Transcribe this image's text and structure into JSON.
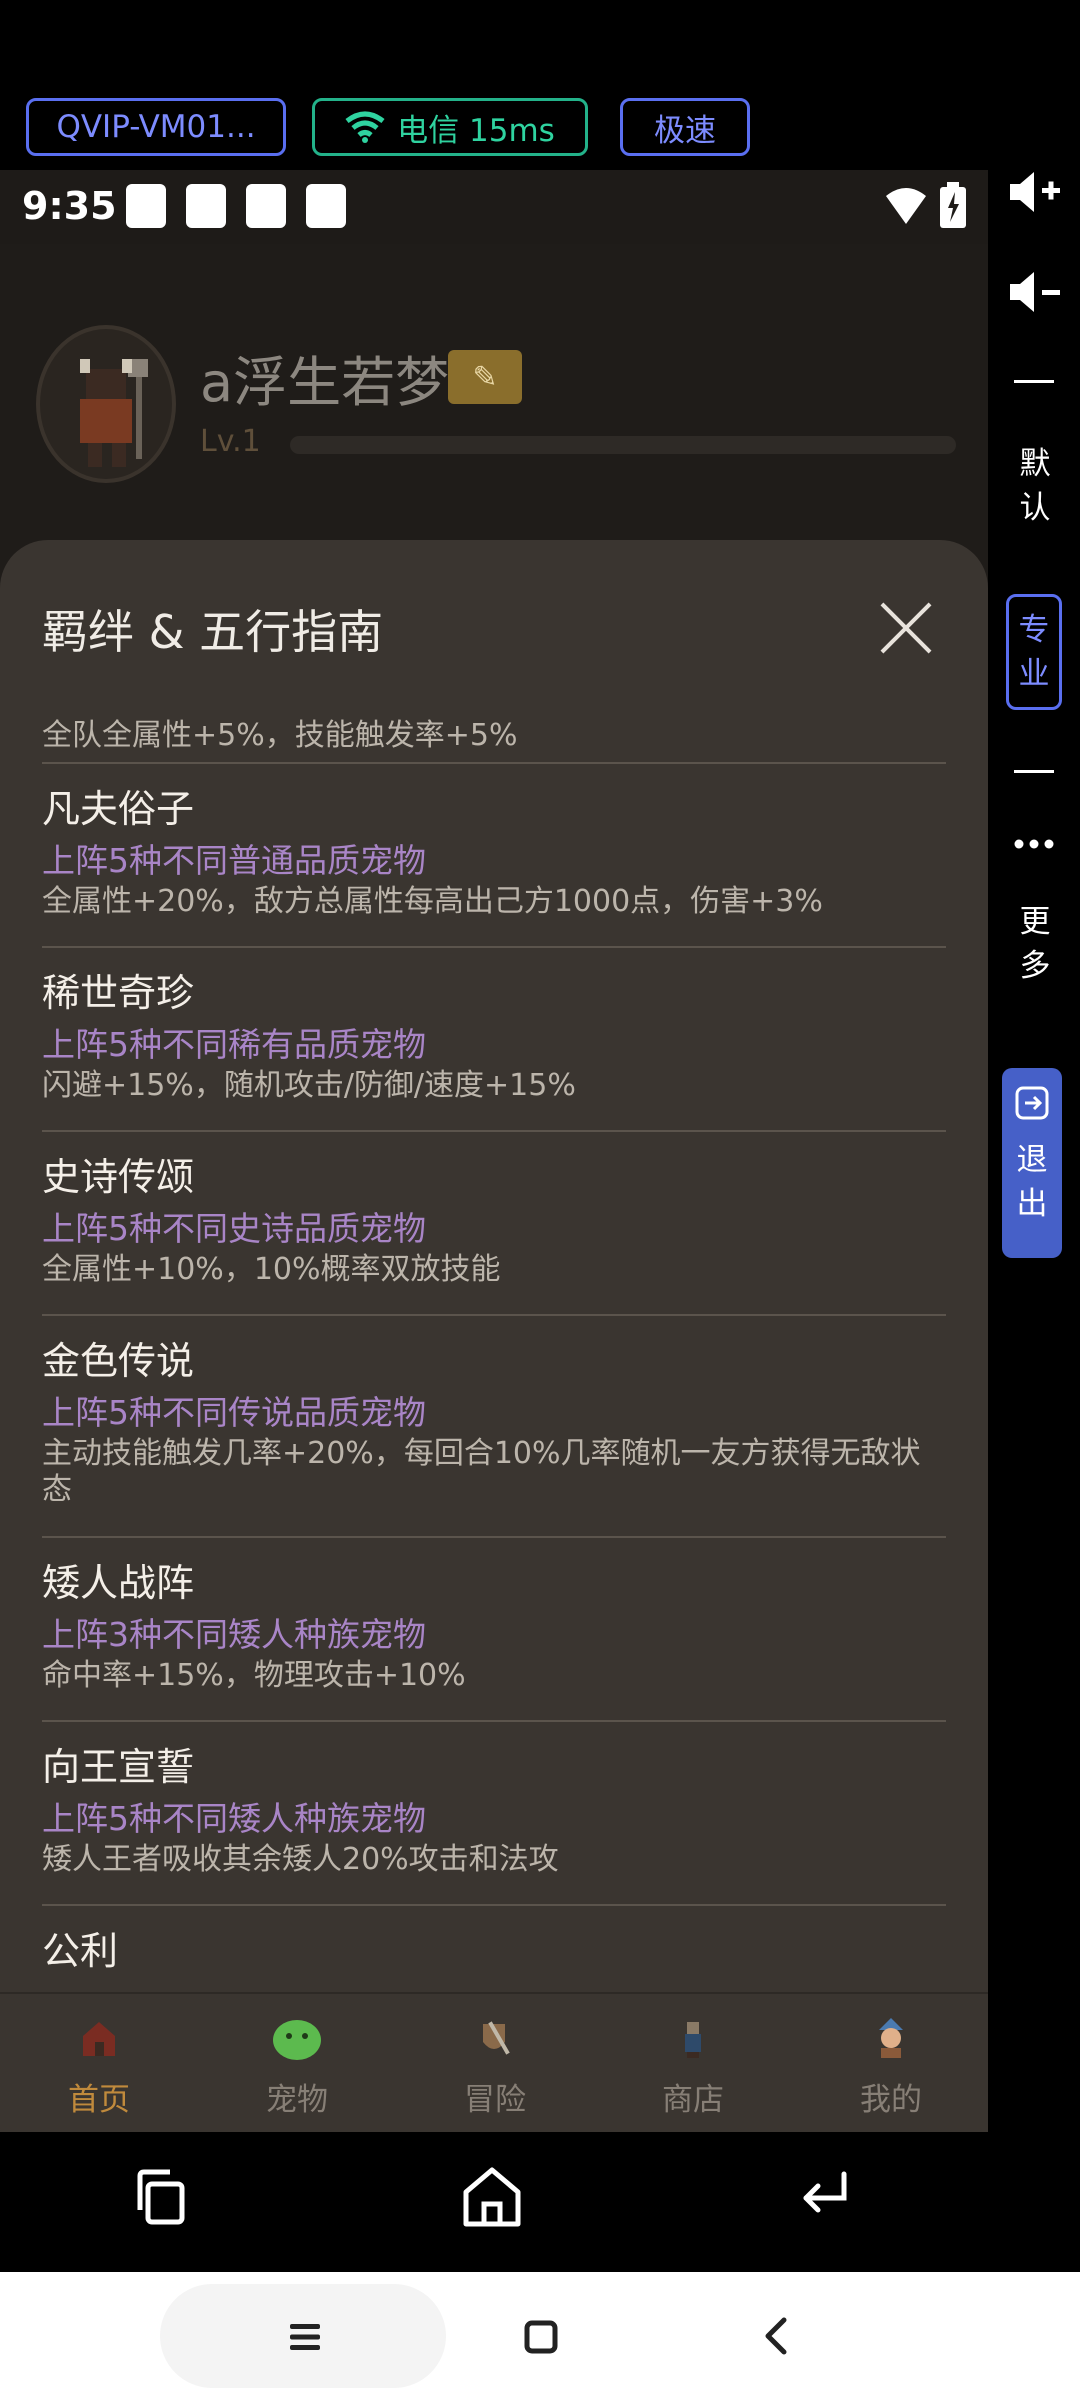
{
  "cloud": {
    "vm_label": "QVIP-VM01...",
    "network_label": "电信 15ms",
    "speed_label": "极速"
  },
  "status": {
    "time": "9:35"
  },
  "profile": {
    "nickname": "a浮生若梦",
    "level": "Lv.1"
  },
  "modal": {
    "title": "羁绊 & 五行指南",
    "first_item_desc": "全队全属性+5%，技能触发率+5%",
    "items": [
      {
        "name": "凡夫俗子",
        "condition": "上阵5种不同普通品质宠物",
        "desc": "全属性+20%，敌方总属性每高出己方1000点，伤害+3%"
      },
      {
        "name": "稀世奇珍",
        "condition": "上阵5种不同稀有品质宠物",
        "desc": "闪避+15%，随机攻击/防御/速度+15%"
      },
      {
        "name": "史诗传颂",
        "condition": "上阵5种不同史诗品质宠物",
        "desc": "全属性+10%，10%概率双放技能"
      },
      {
        "name": "金色传说",
        "condition": "上阵5种不同传说品质宠物",
        "desc": "主动技能触发几率+20%，每回合10%几率随机一友方获得无敌状态"
      },
      {
        "name": "矮人战阵",
        "condition": "上阵3种不同矮人种族宠物",
        "desc": "命中率+15%，物理攻击+10%"
      },
      {
        "name": "向王宣誓",
        "condition": "上阵5种不同矮人种族宠物",
        "desc": "矮人王者吸收其余矮人20%攻击和法攻"
      }
    ],
    "cut_item_name": "公利"
  },
  "tabs": [
    {
      "label": "首页",
      "icon": "house-icon",
      "active": true
    },
    {
      "label": "宠物",
      "icon": "slime-icon",
      "active": false
    },
    {
      "label": "冒险",
      "icon": "shield-sword-icon",
      "active": false
    },
    {
      "label": "商店",
      "icon": "merchant-icon",
      "active": false
    },
    {
      "label": "我的",
      "icon": "character-icon",
      "active": false
    }
  ],
  "side_panel": {
    "default": "默认",
    "pro": "专业",
    "more": "更多",
    "exit": "退出"
  },
  "colors": {
    "accent_purple": "#a985c7",
    "tab_active": "#c08a3c",
    "cloud_blue": "#5a6ff0",
    "cloud_green": "#23b28a"
  }
}
